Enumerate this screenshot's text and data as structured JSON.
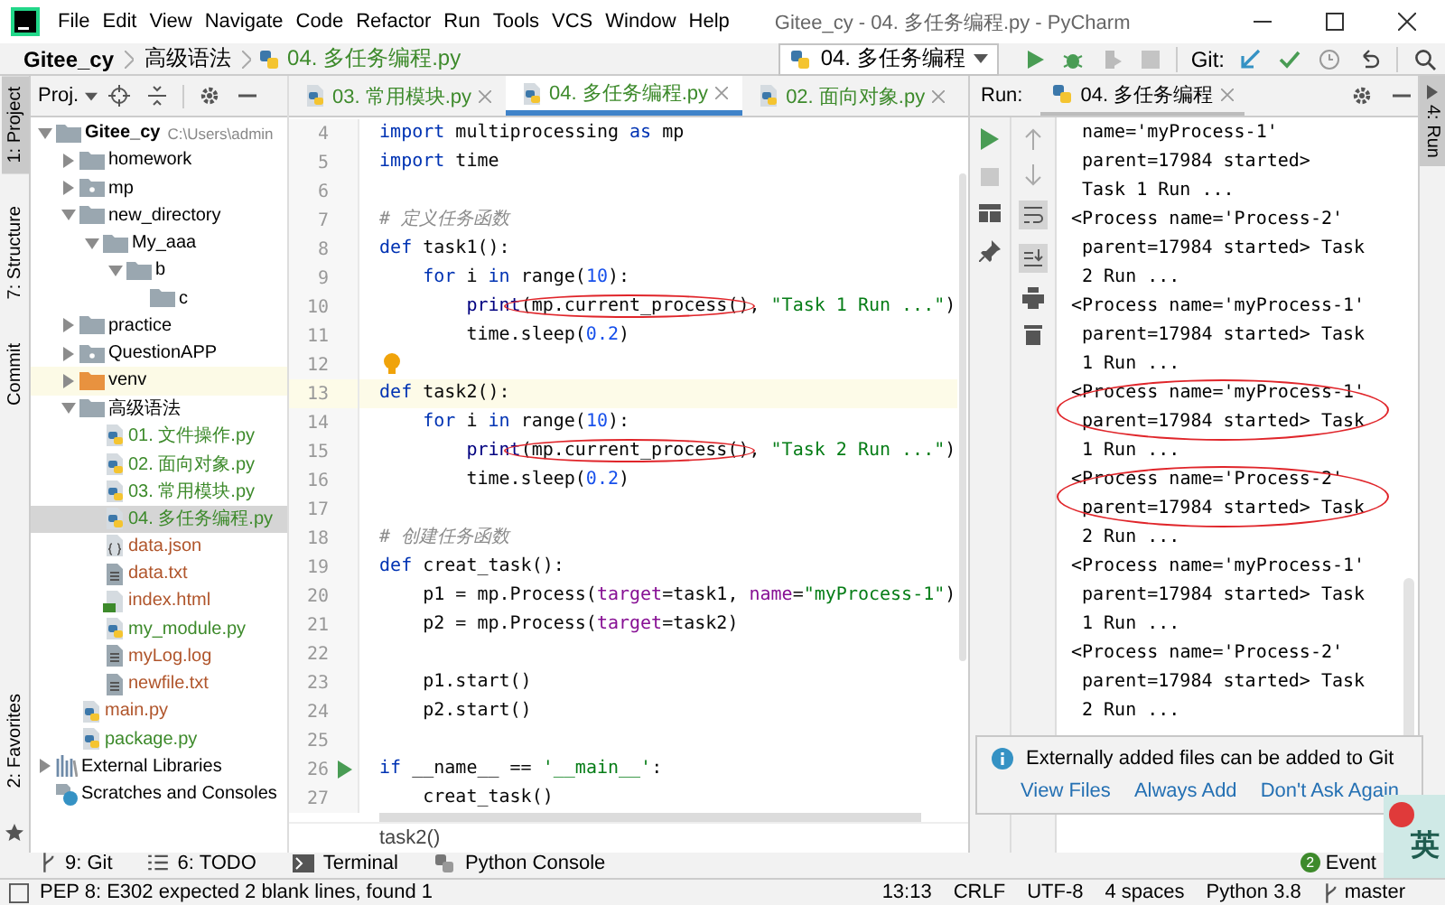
{
  "title_bar": {
    "menu": [
      "File",
      "Edit",
      "View",
      "Navigate",
      "Code",
      "Refactor",
      "Run",
      "Tools",
      "VCS",
      "Window",
      "Help"
    ],
    "title": "Gitee_cy - 04. 多任务编程.py - PyCharm"
  },
  "nav_bar": {
    "breadcrumbs": [
      "Gitee_cy",
      "高级语法",
      "04. 多任务编程.py"
    ],
    "run_config": "04. 多任务编程",
    "git_label": "Git:"
  },
  "left_stripe": [
    {
      "label": "1: Project",
      "selected": true
    },
    {
      "label": "7: Structure",
      "selected": false
    },
    {
      "label": "Commit",
      "selected": false
    },
    {
      "label": "2: Favorites",
      "selected": false
    }
  ],
  "project_panel": {
    "title": "Proj.",
    "tree": [
      {
        "name": "Gitee_cy",
        "kind": "folder",
        "path": "C:\\Users\\admin",
        "expanded": true,
        "selected": false,
        "children": [
          {
            "name": "homework",
            "kind": "folder",
            "expanded": false,
            "selected": false
          },
          {
            "name": "mp",
            "kind": "package",
            "expanded": false,
            "selected": false
          },
          {
            "name": "new_directory",
            "kind": "folder",
            "expanded": true,
            "selected": false,
            "children": [
              {
                "name": "My_aaa",
                "kind": "folder",
                "expanded": true,
                "selected": false,
                "children": [
                  {
                    "name": "b",
                    "kind": "folder",
                    "expanded": true,
                    "selected": false,
                    "children": [
                      {
                        "name": "c",
                        "kind": "folder",
                        "selected": false
                      }
                    ]
                  }
                ]
              }
            ]
          },
          {
            "name": "practice",
            "kind": "folder",
            "expanded": false,
            "selected": false
          },
          {
            "name": "QuestionAPP",
            "kind": "package",
            "expanded": false,
            "selected": false
          },
          {
            "name": "venv",
            "kind": "excluded",
            "expanded": false,
            "selected": false
          },
          {
            "name": "高级语法",
            "kind": "folder",
            "expanded": true,
            "selected": false,
            "children": [
              {
                "name": "01. 文件操作.py",
                "kind": "py",
                "color": "#3d8a2b",
                "selected": false
              },
              {
                "name": "02. 面向对象.py",
                "kind": "py",
                "color": "#3d8a2b",
                "selected": false
              },
              {
                "name": "03. 常用模块.py",
                "kind": "py",
                "color": "#3d8a2b",
                "selected": false
              },
              {
                "name": "04. 多任务编程.py",
                "kind": "py",
                "color": "#3d8a2b",
                "selected": true
              },
              {
                "name": "data.json",
                "kind": "json",
                "color": "#b0552b",
                "selected": false
              },
              {
                "name": "data.txt",
                "kind": "txt",
                "color": "#b0552b",
                "selected": false
              },
              {
                "name": "index.html",
                "kind": "html",
                "color": "#b0552b",
                "selected": false
              },
              {
                "name": "my_module.py",
                "kind": "py",
                "color": "#3d8a2b",
                "selected": false
              },
              {
                "name": "myLog.log",
                "kind": "log",
                "color": "#b0552b",
                "selected": false
              },
              {
                "name": "newfile.txt",
                "kind": "txt",
                "color": "#b0552b",
                "selected": false
              }
            ]
          },
          {
            "name": "main.py",
            "kind": "py",
            "color": "#b0552b",
            "selected": false
          },
          {
            "name": "package.py",
            "kind": "py",
            "color": "#3d8a2b",
            "selected": false
          }
        ]
      },
      {
        "name": "External Libraries",
        "kind": "library",
        "expanded": false,
        "selected": false
      },
      {
        "name": "Scratches and Consoles",
        "kind": "scratch",
        "selected": false
      }
    ]
  },
  "editor": {
    "tabs": [
      {
        "label": "03. 常用模块.py",
        "selected": false
      },
      {
        "label": "04. 多任务编程.py",
        "selected": true
      },
      {
        "label": "02. 面向对象.py",
        "selected": false
      }
    ],
    "lines": [
      {
        "num": "4",
        "tokens": [
          {
            "text": "import",
            "kind": "keyword"
          },
          {
            "text": " multiprocessing ",
            "kind": "plain"
          },
          {
            "text": "as",
            "kind": "keyword"
          },
          {
            "text": " mp",
            "kind": "plain"
          }
        ]
      },
      {
        "num": "5",
        "tokens": [
          {
            "text": "import",
            "kind": "keyword"
          },
          {
            "text": " time",
            "kind": "plain"
          }
        ]
      },
      {
        "num": "6"
      },
      {
        "num": "7",
        "tokens": [
          {
            "text": "# 定义任务函数",
            "kind": "comment"
          }
        ]
      },
      {
        "num": "8",
        "tokens": [
          {
            "text": "def",
            "kind": "keyword"
          },
          {
            "text": " task1():",
            "kind": "plain"
          }
        ]
      },
      {
        "num": "9",
        "tokens": [
          {
            "text": "    for",
            "kind": "keyword"
          },
          {
            "text": " i ",
            "kind": "plain"
          },
          {
            "text": "in",
            "kind": "keyword"
          },
          {
            "text": " range(",
            "kind": "plain"
          },
          {
            "text": "10",
            "kind": "number"
          },
          {
            "text": "):",
            "kind": "plain"
          }
        ]
      },
      {
        "num": "10",
        "tokens": [
          {
            "text": "        print",
            "kind": "builtin"
          },
          {
            "text": "(mp.current_process(),",
            "kind": "plain",
            "circled": true
          },
          {
            "text": " \"Task 1 Run ...\"",
            "kind": "string"
          },
          {
            "text": ")",
            "kind": "plain"
          }
        ]
      },
      {
        "num": "11",
        "tokens": [
          {
            "text": "        time.sleep(",
            "kind": "plain"
          },
          {
            "text": "0.2",
            "kind": "number"
          },
          {
            "text": ")",
            "kind": "plain"
          }
        ]
      },
      {
        "num": "12",
        "bulb": true
      },
      {
        "num": "13",
        "current": true,
        "tokens": [
          {
            "text": "def",
            "kind": "keyword"
          },
          {
            "text": " task2():",
            "kind": "plain"
          }
        ]
      },
      {
        "num": "14",
        "tokens": [
          {
            "text": "    for",
            "kind": "keyword"
          },
          {
            "text": " i ",
            "kind": "plain"
          },
          {
            "text": "in",
            "kind": "keyword"
          },
          {
            "text": " range(",
            "kind": "plain"
          },
          {
            "text": "10",
            "kind": "number"
          },
          {
            "text": "):",
            "kind": "plain"
          }
        ]
      },
      {
        "num": "15",
        "tokens": [
          {
            "text": "        print",
            "kind": "builtin"
          },
          {
            "text": "(mp.current_process(),",
            "kind": "plain",
            "circled": true
          },
          {
            "text": " \"Task 2 Run ...\"",
            "kind": "string"
          },
          {
            "text": ")",
            "kind": "plain"
          }
        ]
      },
      {
        "num": "16",
        "tokens": [
          {
            "text": "        time.sleep(",
            "kind": "plain"
          },
          {
            "text": "0.2",
            "kind": "number"
          },
          {
            "text": ")",
            "kind": "plain"
          }
        ]
      },
      {
        "num": "17"
      },
      {
        "num": "18",
        "tokens": [
          {
            "text": "# 创建任务函数",
            "kind": "comment"
          }
        ]
      },
      {
        "num": "19",
        "tokens": [
          {
            "text": "def",
            "kind": "keyword"
          },
          {
            "text": " creat_task():",
            "kind": "plain"
          }
        ]
      },
      {
        "num": "20",
        "tokens": [
          {
            "text": "    p1 = mp.Process(",
            "kind": "plain"
          },
          {
            "text": "target",
            "kind": "param"
          },
          {
            "text": "=task1, ",
            "kind": "plain"
          },
          {
            "text": "name",
            "kind": "param"
          },
          {
            "text": "=",
            "kind": "plain"
          },
          {
            "text": "\"myProcess-1\"",
            "kind": "string"
          },
          {
            "text": ")",
            "kind": "plain"
          }
        ]
      },
      {
        "num": "21",
        "tokens": [
          {
            "text": "    p2 = mp.Process(",
            "kind": "plain"
          },
          {
            "text": "target",
            "kind": "param"
          },
          {
            "text": "=task2)",
            "kind": "plain"
          }
        ]
      },
      {
        "num": "22"
      },
      {
        "num": "23",
        "tokens": [
          {
            "text": "    p1.start()",
            "kind": "plain"
          }
        ]
      },
      {
        "num": "24",
        "tokens": [
          {
            "text": "    p2.start()",
            "kind": "plain"
          }
        ]
      },
      {
        "num": "25"
      },
      {
        "num": "26",
        "run_marker": true,
        "tokens": [
          {
            "text": "if",
            "kind": "keyword"
          },
          {
            "text": " __name__ == ",
            "kind": "plain"
          },
          {
            "text": "'__main__'",
            "kind": "string"
          },
          {
            "text": ":",
            "kind": "plain"
          }
        ]
      },
      {
        "num": "27",
        "tokens": [
          {
            "text": "    creat_task()",
            "kind": "plain"
          }
        ]
      }
    ],
    "breadcrumb": "task2()"
  },
  "run_panel": {
    "label": "Run:",
    "tab": "04. 多任务编程",
    "output": [
      {
        "continued": true,
        "circled": false,
        "lines": [
          "name='myProcess-1'",
          "parent=17984 started>",
          "Task 1 Run ..."
        ]
      },
      {
        "continued": false,
        "circled": false,
        "lines": [
          "<Process name='Process-2'",
          "parent=17984 started> Task",
          "2 Run ..."
        ]
      },
      {
        "continued": false,
        "circled": false,
        "lines": [
          "<Process name='myProcess-1'",
          "parent=17984 started> Task",
          "1 Run ..."
        ]
      },
      {
        "continued": false,
        "circled": true,
        "lines": [
          "<Process name='myProcess-1'",
          "parent=17984 started> Task",
          "1 Run ..."
        ]
      },
      {
        "continued": false,
        "circled": true,
        "lines": [
          "<Process name='Process-2'",
          "parent=17984 started> Task",
          "2 Run ..."
        ]
      },
      {
        "continued": false,
        "circled": false,
        "lines": [
          "<Process name='myProcess-1'",
          "parent=17984 started> Task",
          "1 Run ..."
        ]
      },
      {
        "continued": false,
        "circled": false,
        "lines": [
          "<Process name='Process-2'",
          "parent=17984 started> Task",
          "2 Run ..."
        ]
      }
    ]
  },
  "right_stripe": [
    {
      "label": "4: Run",
      "selected": true
    }
  ],
  "notification": {
    "message": "Externally added files can be added to Git",
    "actions": [
      "View Files",
      "Always Add",
      "Don't Ask Again"
    ]
  },
  "tool_windows": [
    {
      "label": "9: Git",
      "kind": "git"
    },
    {
      "label": "6: TODO",
      "kind": "todo"
    },
    {
      "label": "Terminal",
      "kind": "terminal"
    },
    {
      "label": "Python Console",
      "kind": "console"
    }
  ],
  "event_log": {
    "badge": "2",
    "label": "Event"
  },
  "ime_badge": "英",
  "status_bar": {
    "message": "PEP 8: E302 expected 2 blank lines, found 1",
    "items": [
      "13:13",
      "CRLF",
      "UTF-8",
      "4 spaces",
      "Python 3.8"
    ],
    "branch": "master"
  }
}
